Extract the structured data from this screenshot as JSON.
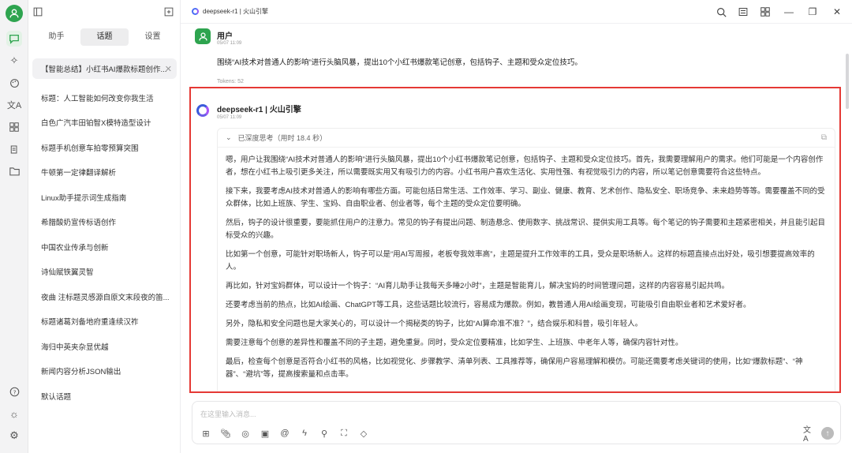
{
  "window": {
    "title": "deepseek-r1 | 火山引擎"
  },
  "rail": {
    "icons": [
      "user-avatar",
      "chat-icon",
      "sparkle-icon",
      "palette-icon",
      "translate-icon",
      "apps-icon",
      "files-icon",
      "folder-icon",
      "help-icon",
      "brightness-icon",
      "settings-icon"
    ]
  },
  "sidebar": {
    "tabs": [
      {
        "label": "助手"
      },
      {
        "label": "话题"
      },
      {
        "label": "设置"
      }
    ],
    "active_tab": "话题",
    "topics": [
      "【智能总结】小红书AI爆款标题创作...",
      "标题：人工智能如何改变你我生活",
      "白色广汽丰田铂智X模特造型设计",
      "标题手机创意车拍零预算突围",
      "牛顿第一定律翻译解析",
      "Linux助手提示词生成指南",
      "希腊酸奶宣传标语创作",
      "中国农业传承与创新",
      "诗仙赋铁翼灵智",
      "夜曲 注标题灵感源自原文末段夜的笛...",
      "标题诸葛刘备地府重逢续汉祚",
      "海归中英夹杂显优越",
      "新闻内容分析JSON输出",
      "默认话题"
    ]
  },
  "chat": {
    "user": {
      "name": "用户",
      "time": "05/07 11:09",
      "text": "围绕“AI技术对普通人的影响”进行头脑风暴，提出10个小红书爆款笔记创意，包括钩子、主题和受众定位技巧。",
      "tokens": "Tokens: 52"
    },
    "assistant": {
      "name": "deepseek-r1 | 火山引擎",
      "time": "05/07 11:09",
      "think_label": "已深度思考（用时 18.4 秒）",
      "paragraphs": [
        "嗯，用户让我围绕“AI技术对普通人的影响”进行头脑风暴，提出10个小红书爆款笔记创意，包括钩子、主题和受众定位技巧。首先，我需要理解用户的需求。他们可能是一个内容创作者，想在小红书上吸引更多关注，所以需要既实用又有吸引力的内容。小红书用户喜欢生活化、实用性强、有视觉吸引力的内容，所以笔记创意需要符合这些特点。",
        "接下来，我要考虑AI技术对普通人的影响有哪些方面。可能包括日常生活、工作效率、学习、副业、健康、教育、艺术创作、隐私安全、职场竞争、未来趋势等等。需要覆盖不同的受众群体，比如上班族、学生、宝妈、自由职业者、创业者等，每个主题的受众定位要明确。",
        "然后，钩子的设计很重要，要能抓住用户的注意力。常见的钩子有提出问题、制造悬念、使用数字、挑战常识、提供实用工具等。每个笔记的钩子需要和主题紧密相关，并且能引起目标受众的兴趣。",
        "比如第一个创意，可能针对职场新人，钩子可以是“用AI写周报，老板夸我效率高”，主题是提升工作效率的工具，受众是职场新人。这样的标题直接点出好处，吸引想要提高效率的人。",
        "再比如，针对宝妈群体，可以设计一个钩子：“AI育儿助手让我每天多睡2小时”，主题是智能育儿，解决宝妈的时间管理问题，这样的内容容易引起共鸣。",
        "还要考虑当前的热点，比如AI绘画、ChatGPT等工具，这些话题比较流行，容易成为爆款。例如，教普通人用AI绘画变现，可能吸引自由职业者和艺术爱好者。",
        "另外，隐私和安全问题也是大家关心的，可以设计一个揭秘类的钩子，比如“AI算命准不准？”，结合娱乐和科普，吸引年轻人。",
        "需要注意每个创意的差异性和覆盖不同的子主题，避免重复。同时，受众定位要精准，比如学生、上班族、中老年人等，确保内容针对性。",
        "最后，检查每个创意是否符合小红书的风格，比如视觉化、步骤教学、清单列表、工具推荐等，确保用户容易理解和模仿。可能还需要考虑关键词的使用，比如“爆款标题”、“神器”、“避坑”等，提高搜索量和点击率。"
      ]
    }
  },
  "input": {
    "placeholder": "在这里输入消息..."
  }
}
